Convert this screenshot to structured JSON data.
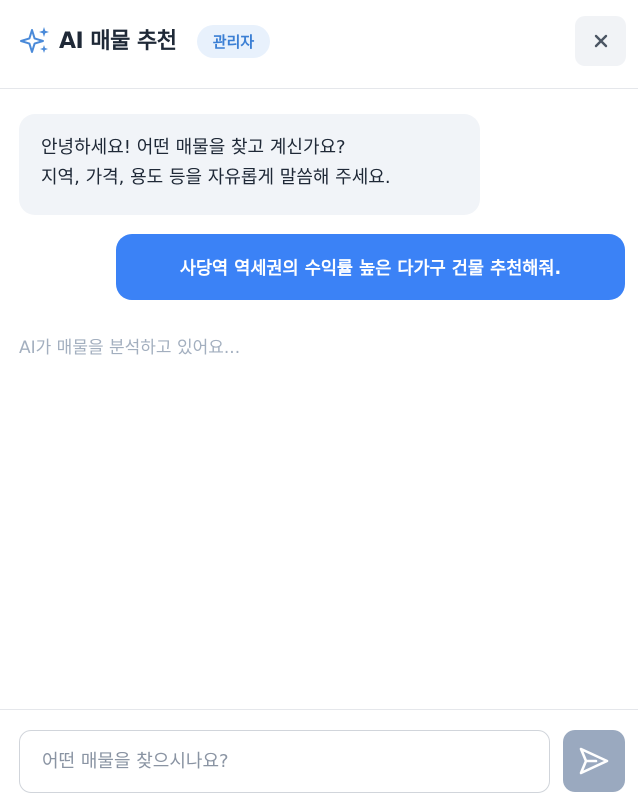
{
  "header": {
    "icon": "sparkles-icon",
    "title": "AI 매물 추천",
    "badge": "관리자",
    "close_icon": "close-icon"
  },
  "messages": [
    {
      "role": "assistant",
      "lines": [
        "안녕하세요! 어떤 매물을 찾고 계신가요?",
        "지역, 가격, 용도 등을 자유롭게 말씀해 주세요."
      ]
    },
    {
      "role": "user",
      "text": "사당역 역세권의 수익률 높은 다가구 건물 추천해줘."
    }
  ],
  "status": {
    "typing_text": "AI가 매물을 분석하고 있어요..."
  },
  "composer": {
    "placeholder": "어떤 매물을 찾으시나요?",
    "value": "",
    "send_icon": "send-icon"
  },
  "colors": {
    "accent": "#3b82f6",
    "sparkle": "#4a8ad9",
    "badge_bg": "#e8f1fc",
    "badge_text": "#3b7fd4",
    "send_disabled": "#9aa9bf"
  }
}
